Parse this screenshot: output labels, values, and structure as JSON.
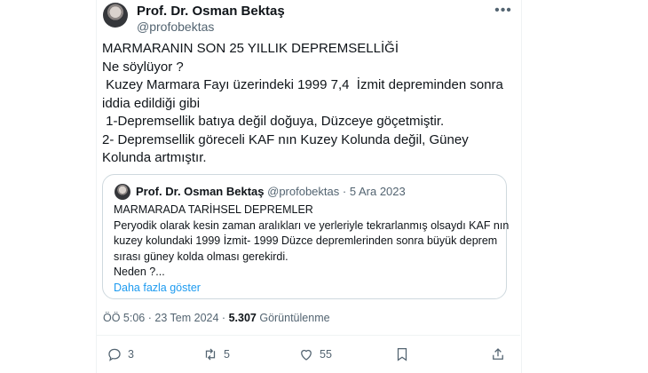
{
  "author": {
    "name": "Prof. Dr. Osman Bektaş",
    "handle": "@profobektas"
  },
  "more_menu": "•••",
  "tweet": {
    "text": "MARMARANIN SON 25 YILLIK DEPREMSELLİĞİ\nNe söylüyor ?\n Kuzey Marmara Fayı üzerindeki 1999 7,4  İzmit depreminden sonra iddia edildiği gibi\n 1-Depremsellik batıya değil doğuya, Düzceye göçetmiştir.\n2- Depremsellik göreceli KAF nın Kuzey Kolunda değil, Güney Kolunda artmıştır."
  },
  "quote": {
    "name": "Prof. Dr. Osman Bektaş",
    "handle": "@profobektas",
    "separator": "·",
    "date": "5 Ara 2023",
    "lines": [
      "MARMARADA TARİHSEL DEPREMLER",
      "Peryodik olarak kesin zaman aralıkları ve yerleriyle tekrarlanmış olsaydı KAF nın",
      "kuzey kolundaki 1999 İzmit- 1999 Düzce depremlerinden sonra büyük deprem",
      "sırası güney kolda olması gerekirdi.",
      "Neden ?..."
    ],
    "show_more": "Daha fazla göster"
  },
  "meta": {
    "time": "ÖÖ 5:06",
    "separator": "·",
    "date": "23 Tem 2024",
    "views_count": "5.307",
    "views_label": "Görüntülenme"
  },
  "actions": {
    "reply": {
      "icon": "reply-icon",
      "count": "3"
    },
    "retweet": {
      "icon": "retweet-icon",
      "count": "5"
    },
    "like": {
      "icon": "heart-icon",
      "count": "55"
    },
    "bookmark": {
      "icon": "bookmark-icon",
      "count": ""
    },
    "share": {
      "icon": "share-icon",
      "count": ""
    }
  }
}
